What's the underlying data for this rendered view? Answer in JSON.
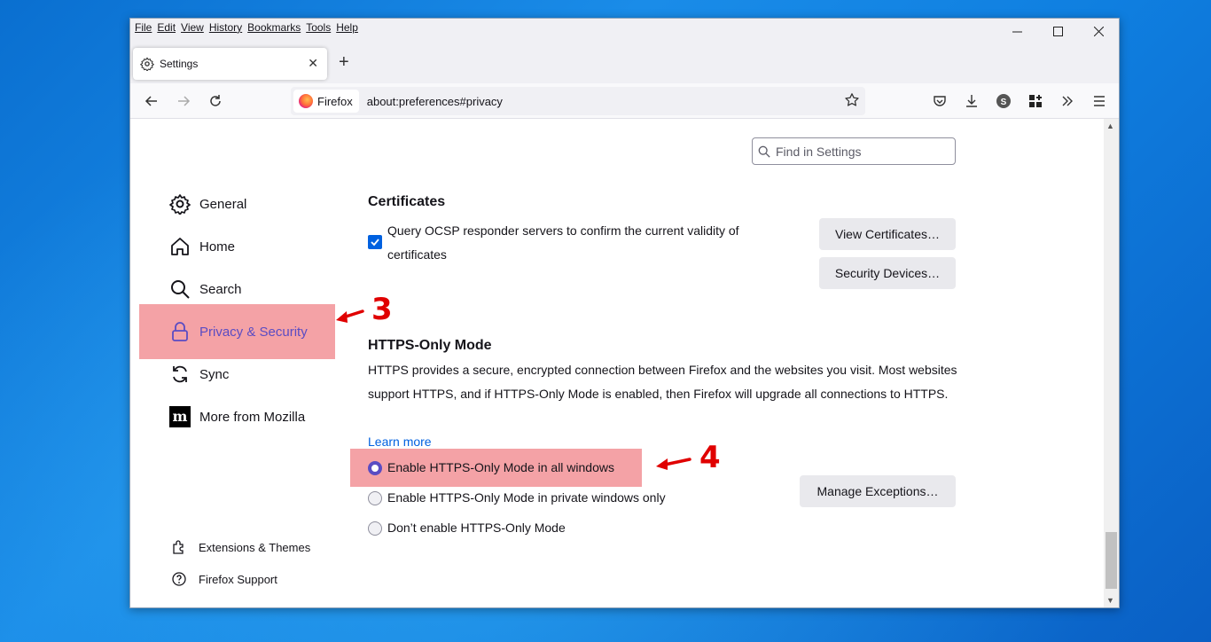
{
  "window": {
    "menu": [
      "File",
      "Edit",
      "View",
      "History",
      "Bookmarks",
      "Tools",
      "Help"
    ],
    "controls": {
      "minimize": "—",
      "maximize": "☐",
      "close": "✕"
    }
  },
  "tab": {
    "title": "Settings",
    "close": "✕",
    "new_tab": "+"
  },
  "navbar": {
    "identity_label": "Firefox",
    "url": "about:preferences#privacy"
  },
  "search": {
    "placeholder": "Find in Settings"
  },
  "sidebar": {
    "items": [
      {
        "label": "General",
        "icon": "gear-icon"
      },
      {
        "label": "Home",
        "icon": "home-icon"
      },
      {
        "label": "Search",
        "icon": "search-icon"
      },
      {
        "label": "Privacy & Security",
        "icon": "lock-icon",
        "active": true
      },
      {
        "label": "Sync",
        "icon": "sync-icon"
      },
      {
        "label": "More from Mozilla",
        "icon": "mozilla-icon"
      }
    ],
    "footer": [
      {
        "label": "Extensions & Themes",
        "icon": "puzzle-icon"
      },
      {
        "label": "Firefox Support",
        "icon": "help-icon"
      }
    ]
  },
  "certificates": {
    "heading": "Certificates",
    "ocsp_label": "Query OCSP responder servers to confirm the current validity of certificates",
    "ocsp_checked": true,
    "view_button": "View Certificates…",
    "devices_button": "Security Devices…"
  },
  "https_only": {
    "heading": "HTTPS-Only Mode",
    "description": "HTTPS provides a secure, encrypted connection between Firefox and the websites you visit. Most websites support HTTPS, and if HTTPS-Only Mode is enabled, then Firefox will upgrade all connections to HTTPS.",
    "learn_more": "Learn more",
    "options": [
      {
        "label": "Enable HTTPS-Only Mode in all windows",
        "selected": true
      },
      {
        "label": "Enable HTTPS-Only Mode in private windows only",
        "selected": false
      },
      {
        "label": "Don’t enable HTTPS-Only Mode",
        "selected": false
      }
    ],
    "manage_button": "Manage Exceptions…"
  },
  "annotations": {
    "step3": "3",
    "step4": "4"
  },
  "colors": {
    "highlight": "#f4a2a6",
    "accent": "#5a4cc3",
    "link": "#0061e0",
    "annotation": "#e00000"
  }
}
